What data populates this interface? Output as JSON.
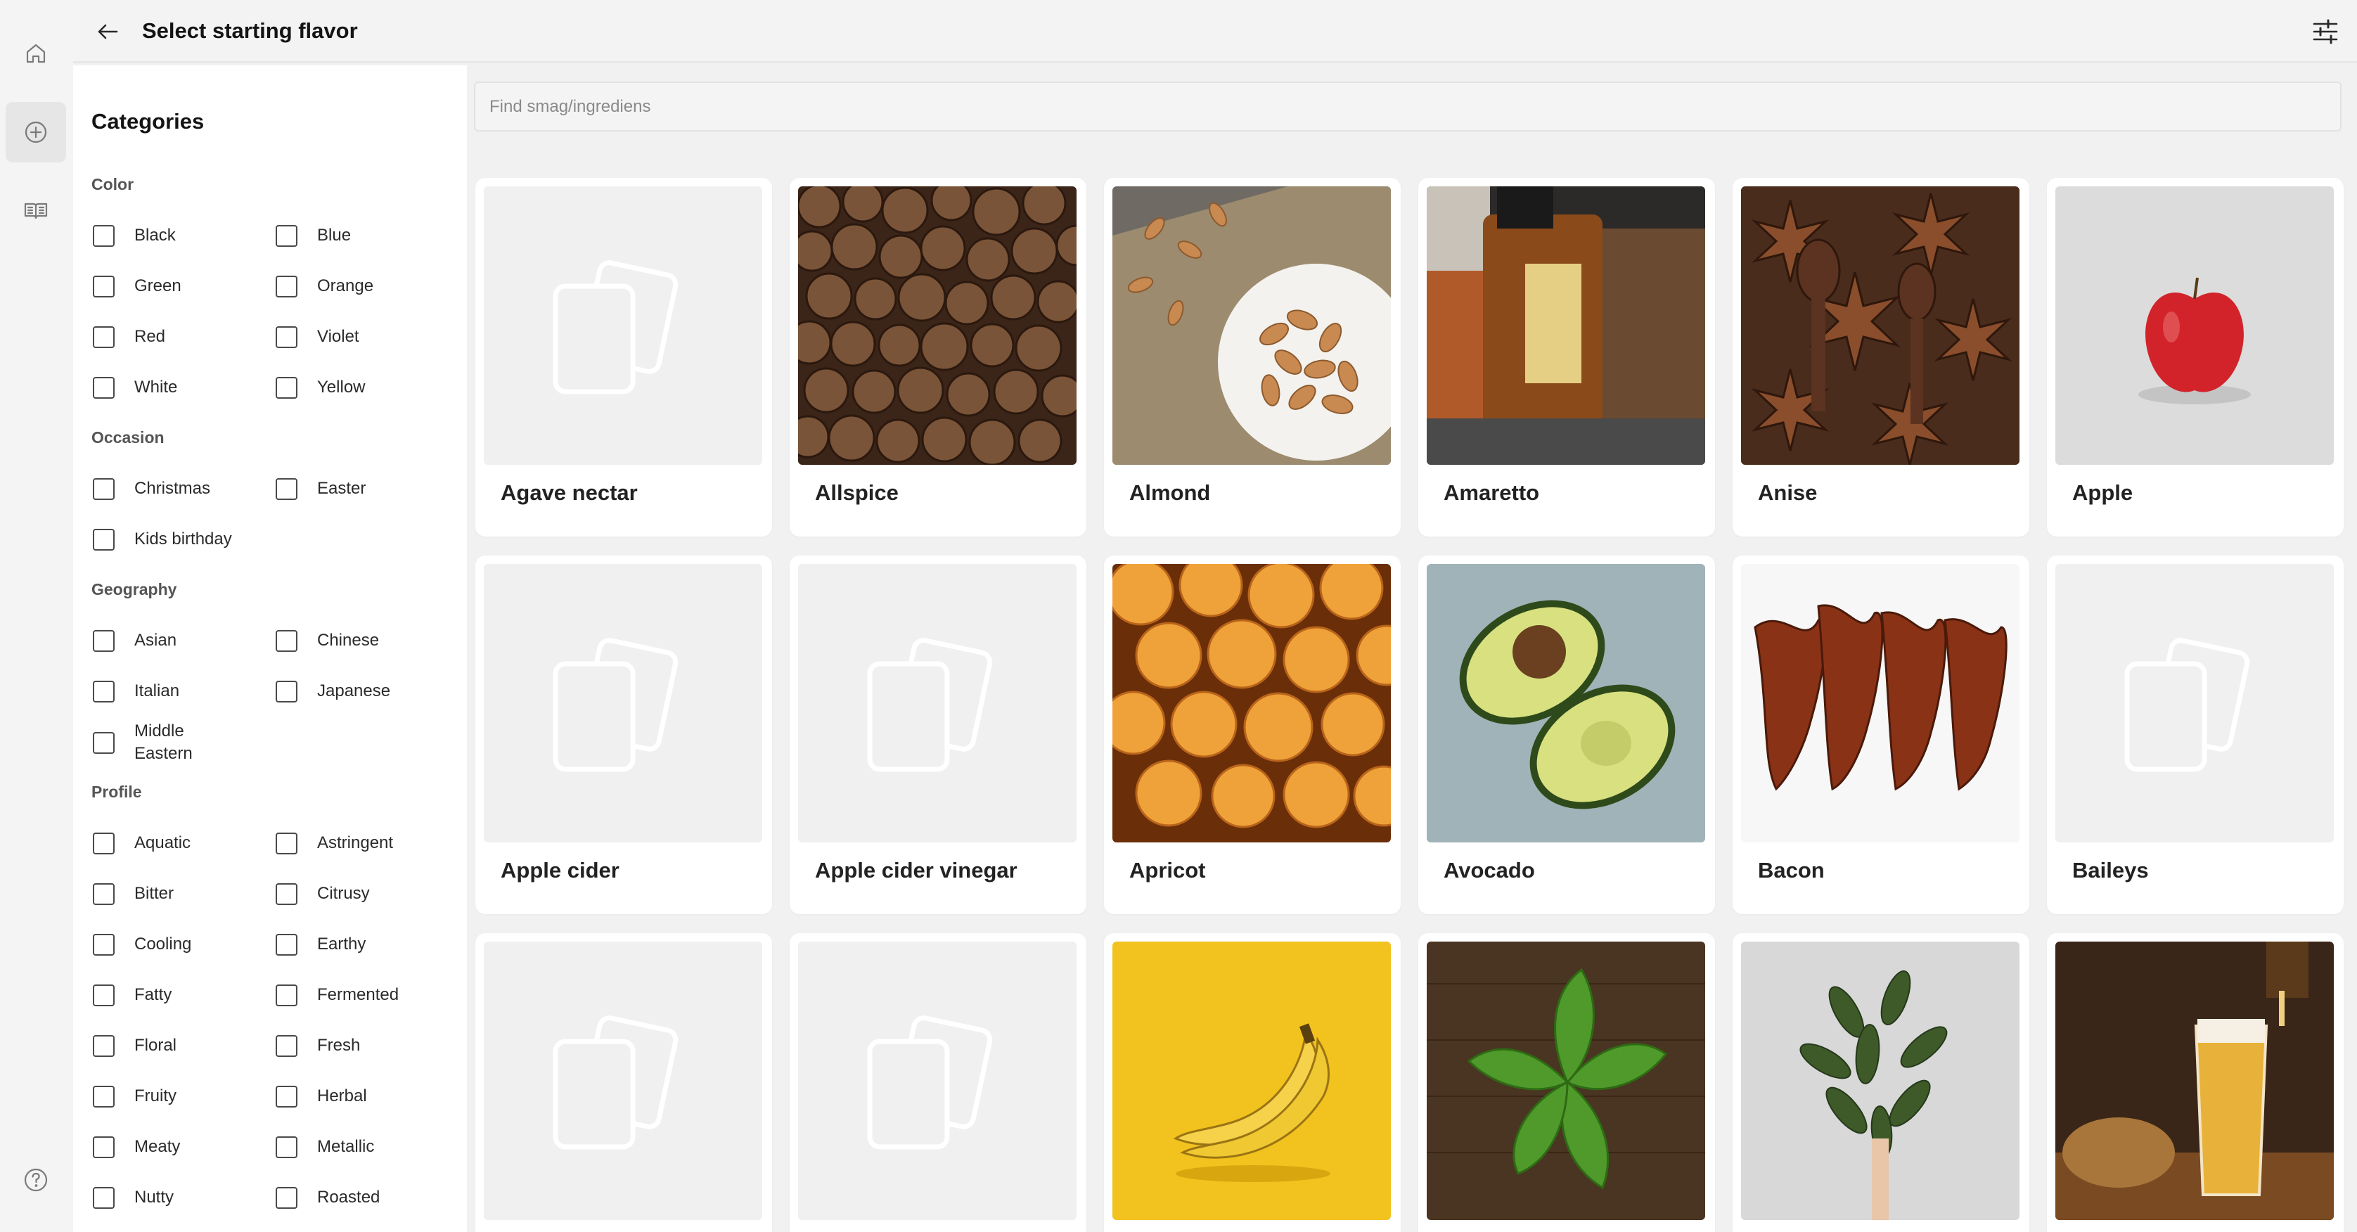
{
  "header": {
    "title": "Select starting flavor"
  },
  "nav": {
    "icons": [
      "home-icon",
      "add-circle-icon",
      "book-icon",
      "help-icon"
    ]
  },
  "sidebar": {
    "heading": "Categories",
    "groups": [
      {
        "title": "Color",
        "items": [
          "Black",
          "Blue",
          "Green",
          "Orange",
          "Red",
          "Violet",
          "White",
          "Yellow"
        ]
      },
      {
        "title": "Occasion",
        "items": [
          "Christmas",
          "Easter",
          "Kids birthday"
        ]
      },
      {
        "title": "Geography",
        "items": [
          "Asian",
          "Chinese",
          "Italian",
          "Japanese",
          "Middle Eastern"
        ]
      },
      {
        "title": "Profile",
        "items": [
          "Aquatic",
          "Astringent",
          "Bitter",
          "Citrusy",
          "Cooling",
          "Earthy",
          "Fatty",
          "Fermented",
          "Floral",
          "Fresh",
          "Fruity",
          "Herbal",
          "Meaty",
          "Metallic",
          "Nutty",
          "Roasted"
        ]
      }
    ]
  },
  "search": {
    "placeholder": "Find smag/ingrediens",
    "value": ""
  },
  "flavors": [
    {
      "name": "Agave nectar",
      "image": "placeholder"
    },
    {
      "name": "Allspice",
      "image": "allspice-photo"
    },
    {
      "name": "Almond",
      "image": "almond-photo"
    },
    {
      "name": "Amaretto",
      "image": "amaretto-photo"
    },
    {
      "name": "Anise",
      "image": "anise-photo"
    },
    {
      "name": "Apple",
      "image": "apple-photo"
    },
    {
      "name": "Apple cider",
      "image": "placeholder"
    },
    {
      "name": "Apple cider vinegar",
      "image": "placeholder"
    },
    {
      "name": "Apricot",
      "image": "apricot-photo"
    },
    {
      "name": "Avocado",
      "image": "avocado-photo"
    },
    {
      "name": "Bacon",
      "image": "bacon-photo"
    },
    {
      "name": "Baileys",
      "image": "placeholder"
    },
    {
      "name": "",
      "image": "placeholder"
    },
    {
      "name": "",
      "image": "placeholder"
    },
    {
      "name": "",
      "image": "banana-photo"
    },
    {
      "name": "",
      "image": "basil-photo"
    },
    {
      "name": "",
      "image": "bay-leaf-photo"
    },
    {
      "name": "",
      "image": "beer-photo"
    }
  ],
  "colors": {
    "background": "#f1f1f1",
    "card": "#ffffff",
    "placeholder": "#f0f0f0"
  }
}
